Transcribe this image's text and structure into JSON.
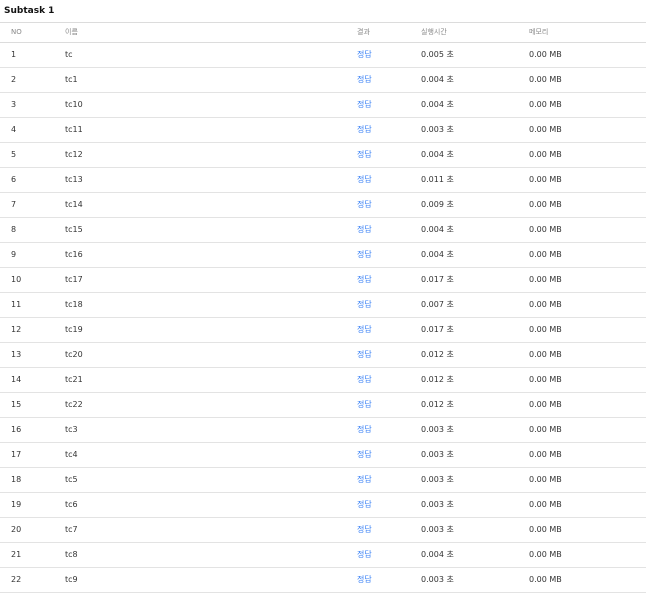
{
  "subtask_title": "Subtask 1",
  "table": {
    "headers": {
      "no": "NO",
      "name": "이름",
      "result": "결과",
      "time": "실행시간",
      "memory": "메모리"
    },
    "rows": [
      {
        "no": "1",
        "name": "tc",
        "result": "정답",
        "time": "0.005 초",
        "memory": "0.00 MB"
      },
      {
        "no": "2",
        "name": "tc1",
        "result": "정답",
        "time": "0.004 초",
        "memory": "0.00 MB"
      },
      {
        "no": "3",
        "name": "tc10",
        "result": "정답",
        "time": "0.004 초",
        "memory": "0.00 MB"
      },
      {
        "no": "4",
        "name": "tc11",
        "result": "정답",
        "time": "0.003 초",
        "memory": "0.00 MB"
      },
      {
        "no": "5",
        "name": "tc12",
        "result": "정답",
        "time": "0.004 초",
        "memory": "0.00 MB"
      },
      {
        "no": "6",
        "name": "tc13",
        "result": "정답",
        "time": "0.011 초",
        "memory": "0.00 MB"
      },
      {
        "no": "7",
        "name": "tc14",
        "result": "정답",
        "time": "0.009 초",
        "memory": "0.00 MB"
      },
      {
        "no": "8",
        "name": "tc15",
        "result": "정답",
        "time": "0.004 초",
        "memory": "0.00 MB"
      },
      {
        "no": "9",
        "name": "tc16",
        "result": "정답",
        "time": "0.004 초",
        "memory": "0.00 MB"
      },
      {
        "no": "10",
        "name": "tc17",
        "result": "정답",
        "time": "0.017 초",
        "memory": "0.00 MB"
      },
      {
        "no": "11",
        "name": "tc18",
        "result": "정답",
        "time": "0.007 초",
        "memory": "0.00 MB"
      },
      {
        "no": "12",
        "name": "tc19",
        "result": "정답",
        "time": "0.017 초",
        "memory": "0.00 MB"
      },
      {
        "no": "13",
        "name": "tc20",
        "result": "정답",
        "time": "0.012 초",
        "memory": "0.00 MB"
      },
      {
        "no": "14",
        "name": "tc21",
        "result": "정답",
        "time": "0.012 초",
        "memory": "0.00 MB"
      },
      {
        "no": "15",
        "name": "tc22",
        "result": "정답",
        "time": "0.012 초",
        "memory": "0.00 MB"
      },
      {
        "no": "16",
        "name": "tc3",
        "result": "정답",
        "time": "0.003 초",
        "memory": "0.00 MB"
      },
      {
        "no": "17",
        "name": "tc4",
        "result": "정답",
        "time": "0.003 초",
        "memory": "0.00 MB"
      },
      {
        "no": "18",
        "name": "tc5",
        "result": "정답",
        "time": "0.003 초",
        "memory": "0.00 MB"
      },
      {
        "no": "19",
        "name": "tc6",
        "result": "정답",
        "time": "0.003 초",
        "memory": "0.00 MB"
      },
      {
        "no": "20",
        "name": "tc7",
        "result": "정답",
        "time": "0.003 초",
        "memory": "0.00 MB"
      },
      {
        "no": "21",
        "name": "tc8",
        "result": "정답",
        "time": "0.004 초",
        "memory": "0.00 MB"
      },
      {
        "no": "22",
        "name": "tc9",
        "result": "정답",
        "time": "0.003 초",
        "memory": "0.00 MB"
      }
    ]
  },
  "colors": {
    "accepted": "#3b82f6",
    "header_text": "#888888",
    "row_border": "#e3e3e3"
  }
}
